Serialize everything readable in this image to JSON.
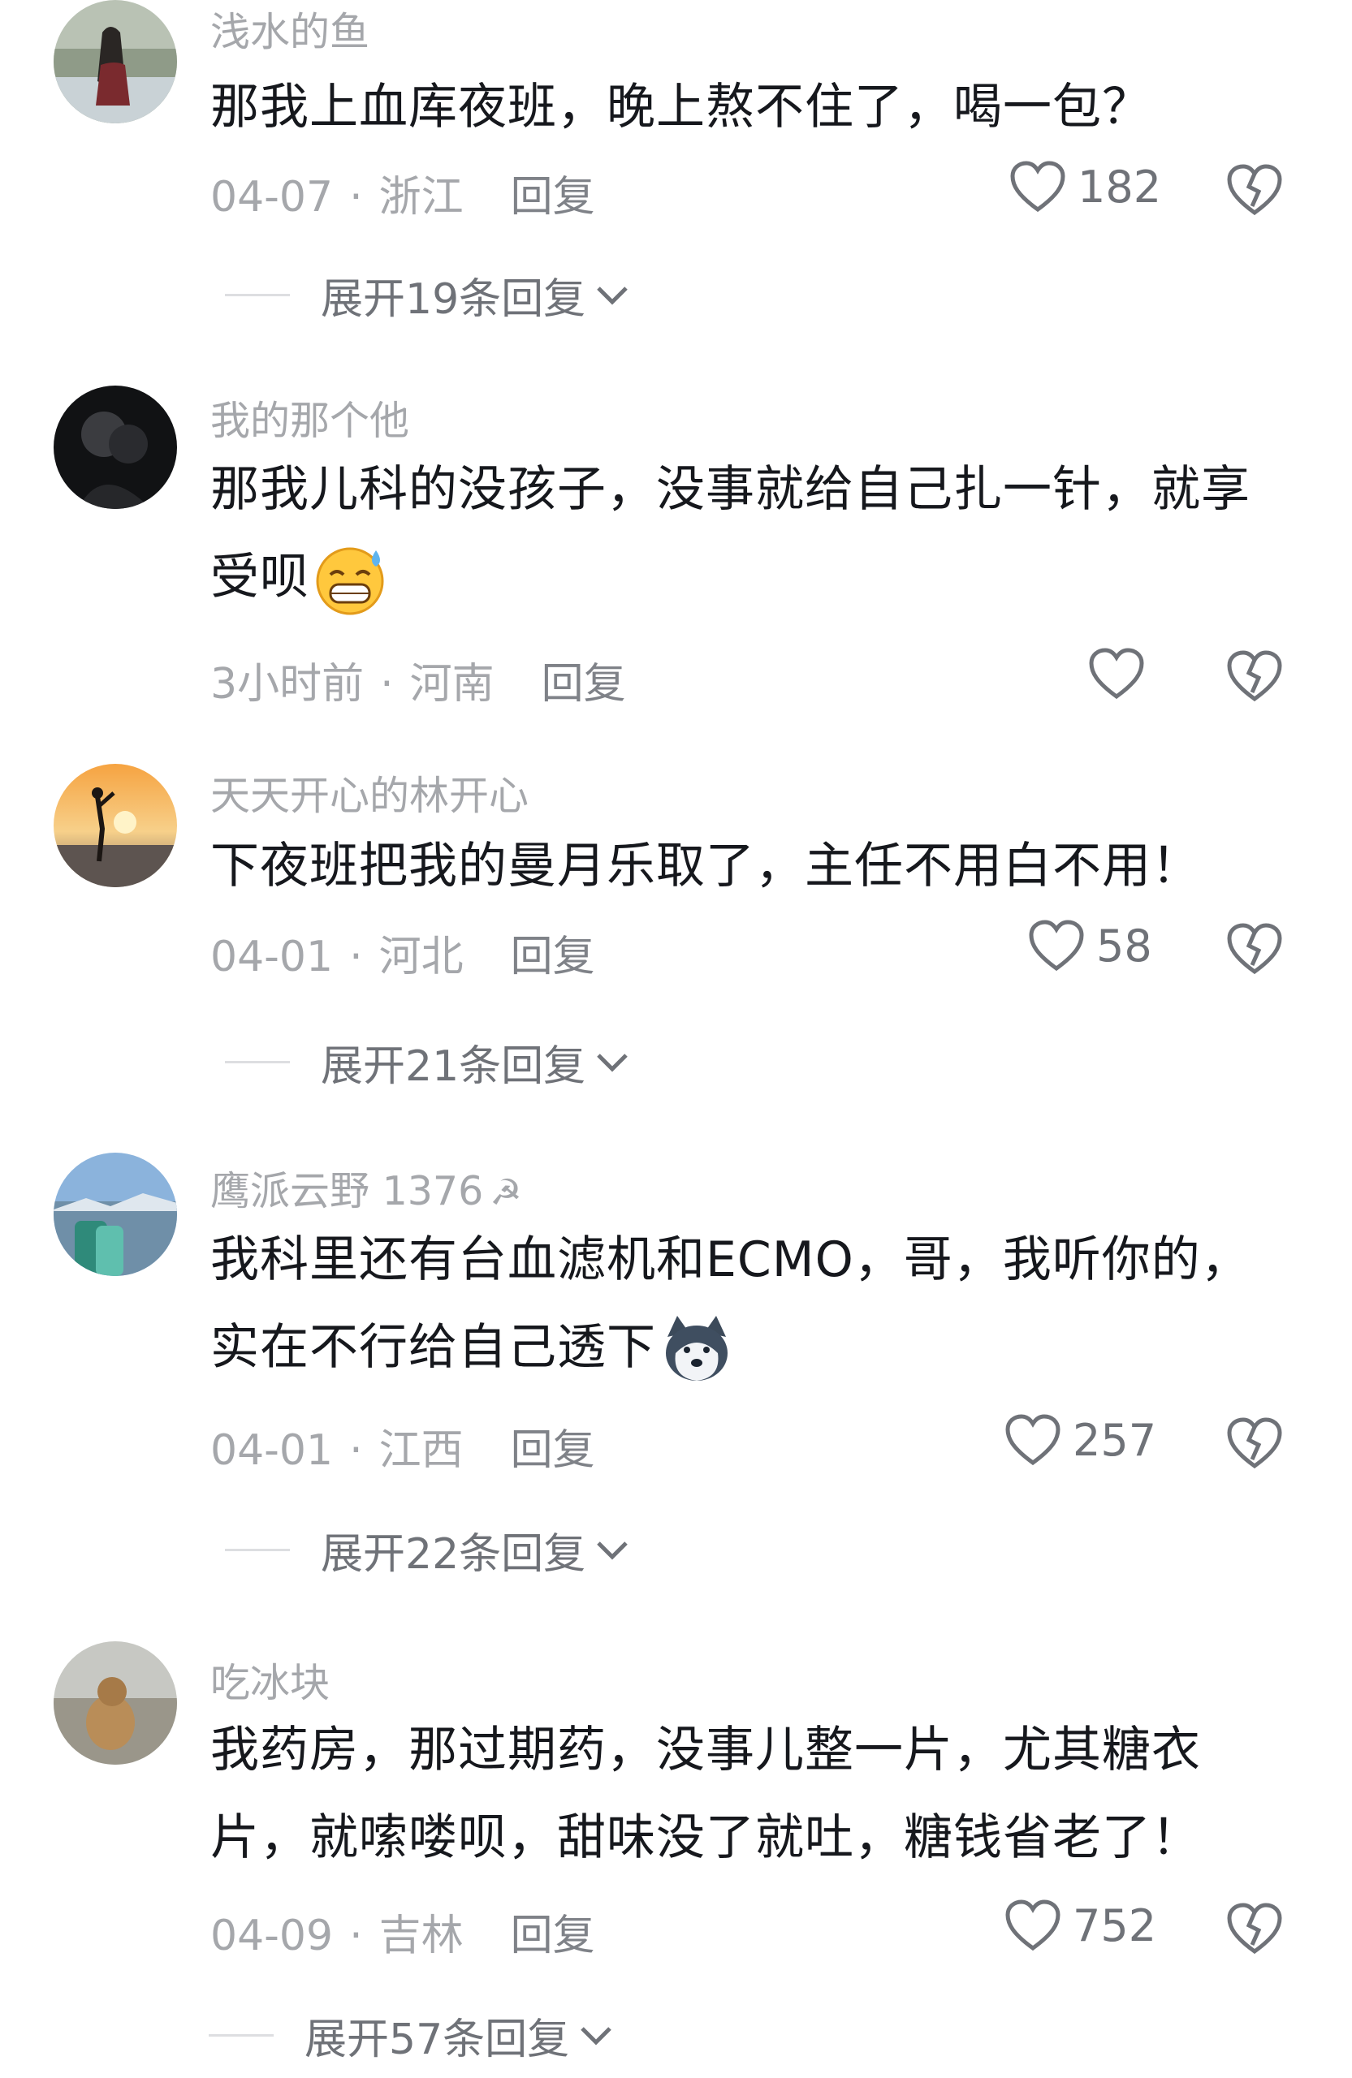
{
  "comments": [
    {
      "username": "浅水的鱼",
      "text": "那我上血库夜班，晚上熬不住了，喝一包？",
      "date": "04-07",
      "location": "浙江",
      "reply_label": "回复",
      "likes": "182",
      "expand_label": "展开19条回复"
    },
    {
      "username": "我的那个他",
      "text": "那我儿科的没孩子，没事就给自己扎一针，就享受呗",
      "emoji": "grinning-sweat-emoji",
      "date": "3小时前",
      "location": "河南",
      "reply_label": "回复",
      "likes": ""
    },
    {
      "username": "天天开心的林开心",
      "text": "下夜班把我的曼月乐取了，主任不用白不用！",
      "date": "04-01",
      "location": "河北",
      "reply_label": "回复",
      "likes": "58",
      "expand_label": "展开21条回复"
    },
    {
      "username": "鹰派云野 1376",
      "badge_icon": "hammer-sickle-icon",
      "text": "我科里还有台血滤机和ECMO，哥，我听你的，实在不行给自己透下",
      "emoji": "husky-dog-emoji",
      "date": "04-01",
      "location": "江西",
      "reply_label": "回复",
      "likes": "257",
      "expand_label": "展开22条回复"
    },
    {
      "username": "吃冰块",
      "text": "我药房，那过期药，没事儿整一片，尤其糖衣片，就嗦喽呗，甜味没了就吐，糖钱省老了！",
      "date": "04-09",
      "location": "吉林",
      "reply_label": "回复",
      "likes": "752",
      "expand_label": "展开57条回复"
    }
  ],
  "icons": {
    "like": "heart-outline-icon",
    "dislike": "broken-heart-icon",
    "expand": "chevron-down-icon"
  },
  "colors": {
    "username": "#a5a7ab",
    "text": "#16181d",
    "meta": "#a5a7ab"
  }
}
